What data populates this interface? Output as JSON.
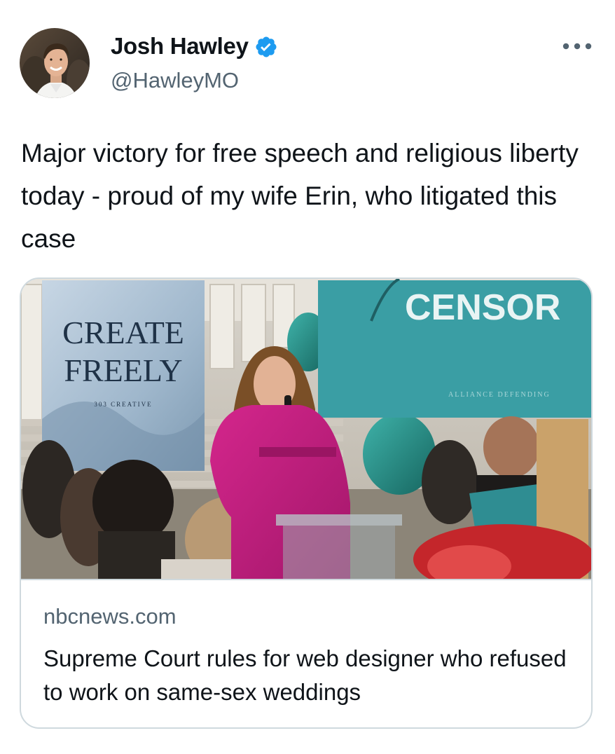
{
  "author": {
    "name": "Josh Hawley",
    "handle": "@HawleyMO",
    "verified": true,
    "avatar_icon": "profile-photo",
    "verified_icon": "verified-badge-icon"
  },
  "menu": {
    "icon": "more-options-icon"
  },
  "tweet": {
    "text": "Major victory for free speech and religious liberty today - proud of my wife Erin, who litigated this case"
  },
  "link_card": {
    "image_text": {
      "left_sign_line1": "CREATE",
      "left_sign_line2": "FREELY",
      "left_sign_small": "303 CREATIVE",
      "right_sign": "CENSOR",
      "right_sign_small": "ALLIANCE DEFENDING"
    },
    "domain": "nbcnews.com",
    "title": "Supreme Court rules for web designer who refused to work on same-sex weddings"
  },
  "colors": {
    "text_primary": "#0f1419",
    "text_secondary": "#536471",
    "verified_blue": "#1d9bf0",
    "border": "#cfd9de",
    "teal_sign": "#3a9ea4",
    "magenta_coat": "#c8207e"
  }
}
